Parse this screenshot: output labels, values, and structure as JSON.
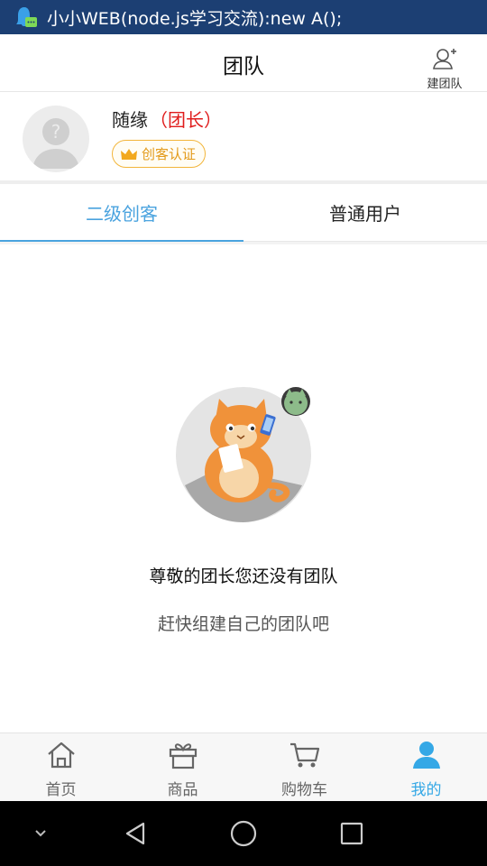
{
  "status_bar": {
    "notification_text": "小小WEB(node.js学习交流):new A();"
  },
  "header": {
    "title": "团队",
    "create_team_label": "建团队"
  },
  "profile": {
    "username": "随缘",
    "role": "（团长）",
    "badge_label": "创客认证"
  },
  "tabs": [
    {
      "label": "二级创客",
      "active": true
    },
    {
      "label": "普通用户",
      "active": false
    }
  ],
  "empty_state": {
    "title": "尊敬的团长您还没有团队",
    "subtitle": "赶快组建自己的团队吧"
  },
  "bottom_nav": [
    {
      "label": "首页",
      "icon": "home-icon",
      "active": false
    },
    {
      "label": "商品",
      "icon": "gift-icon",
      "active": false
    },
    {
      "label": "购物车",
      "icon": "cart-icon",
      "active": false
    },
    {
      "label": "我的",
      "icon": "person-icon",
      "active": true
    }
  ],
  "colors": {
    "status_bar": "#1c3f73",
    "accent": "#4aa3df",
    "role_red": "#e01c1c",
    "badge_gold": "#f2b53a"
  }
}
